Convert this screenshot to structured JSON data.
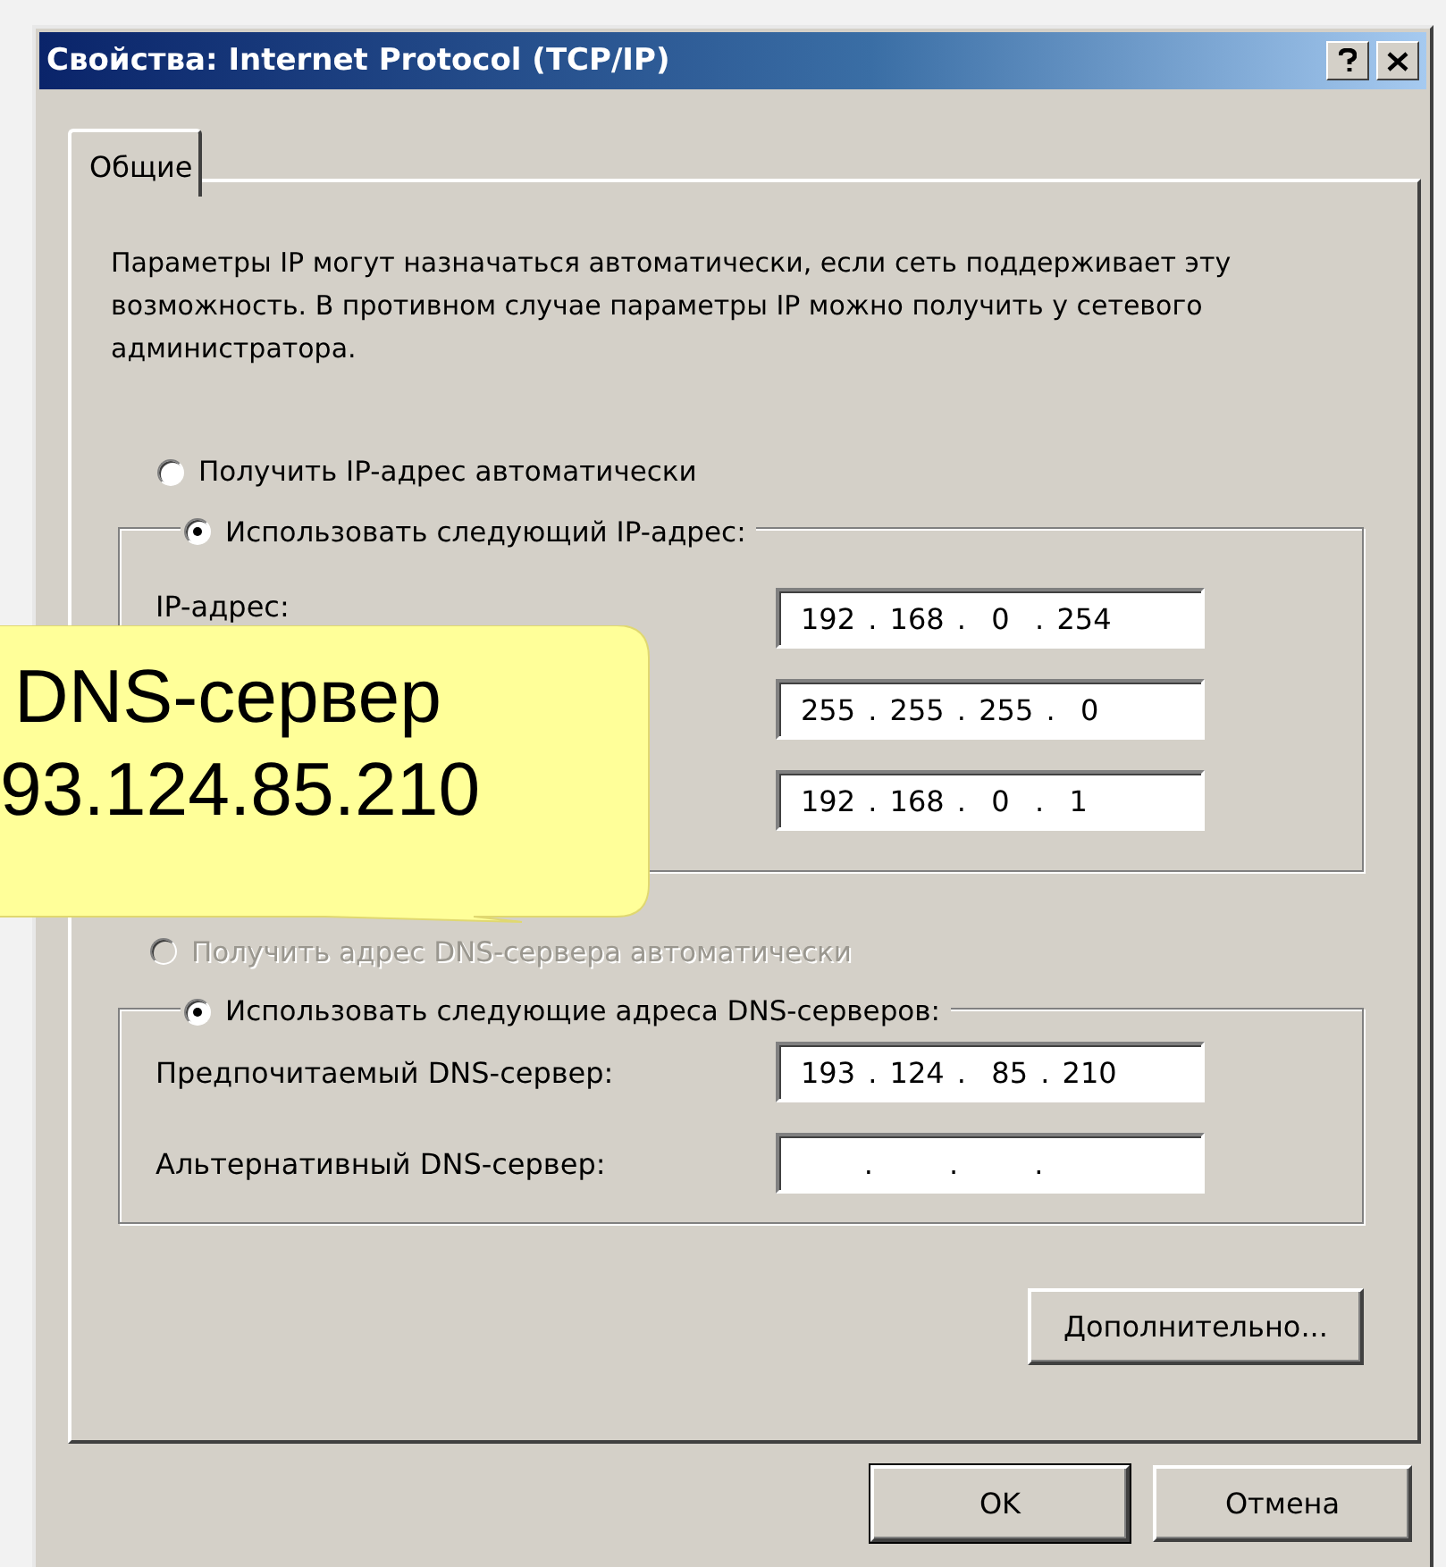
{
  "window": {
    "title": "Свойства: Internet Protocol (TCP/IP)"
  },
  "tabs": [
    {
      "label": "Общие",
      "selected": true
    }
  ],
  "description": "Параметры IP могут назначаться автоматически, если сеть поддерживает эту возможность. В противном случае параметры IP можно получить у сетевого администратора.",
  "ip_auto": {
    "label": "Получить IP-адрес автоматически",
    "selected": false,
    "disabled": false
  },
  "ip_group": {
    "radio": {
      "label": "Использовать следующий IP-адрес:",
      "selected": true,
      "disabled": false
    },
    "rows": [
      {
        "label": "IP-адрес:",
        "value": "192 . 168 .  0  . 254"
      },
      {
        "value": "255 . 255 . 255 .  0"
      },
      {
        "value": "192 . 168 .  0  .  1"
      }
    ]
  },
  "dns_auto": {
    "label": "Получить адрес DNS-сервера автоматически",
    "selected": false,
    "disabled": true
  },
  "dns_group": {
    "radio": {
      "label": "Использовать следующие адреса DNS-серверов:",
      "selected": true,
      "disabled": false
    },
    "rows": [
      {
        "label": "Предпочитаемый DNS-сервер:",
        "value": "193 . 124 .  85 . 210"
      },
      {
        "label": "Альтернативный DNS-сервер:",
        "value": "     .      .      .   "
      }
    ]
  },
  "advanced_button": "Дополнительно...",
  "buttons": [
    {
      "label": "OK",
      "default": true
    },
    {
      "label": "Отмена",
      "default": false
    }
  ],
  "callout": {
    "lines": [
      "DNS-сервер",
      "93.124.85.210"
    ]
  }
}
